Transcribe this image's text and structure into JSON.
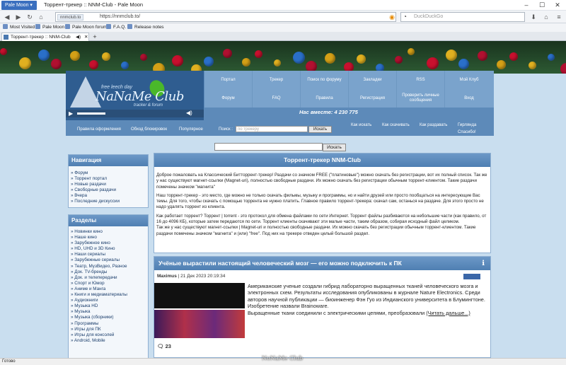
{
  "browser": {
    "app_button": "Pale Moon",
    "window_title": "Торрент-трекер :: NNM-Club - Pale Moon",
    "url_site": "nnmclub.to",
    "url": "https://nnmclub.to/",
    "search_placeholder": "DuckDuckGo",
    "bookmarks": [
      "Most Visited",
      "Pale Moon",
      "Pale Moon forum",
      "F.A.Q.",
      "Release notes"
    ],
    "tab_title": "Торрент-трекер :: NNM-Club",
    "status": "Готово"
  },
  "site": {
    "logo_top": "free leech day",
    "logo": "NaNaMe Club",
    "logo_sub": "tracker & forum",
    "watermark": "NoNaMe Club",
    "menu": [
      "Портал",
      "Трекер",
      "Поиск по форуму",
      "Закладки",
      "RSS",
      "Мой Клуб",
      "Форум",
      "FAQ",
      "Правила",
      "Регистрация",
      "Проверить личные сообщения",
      "Вход"
    ],
    "online": "Нас вместе: 4 230 775",
    "links": [
      "Правила оформления",
      "Обход блокировок",
      "Популярное"
    ],
    "search_label": "Поиск :",
    "search_placeholder": "по трекеру",
    "search_button": "Искать",
    "right_links": [
      "Как искать",
      "Как скачивать",
      "Как раздавать",
      "Гирлянда",
      "Спасибо!"
    ],
    "main_search_button": "Искать"
  },
  "nav": {
    "title": "Навигация",
    "items": [
      "Форум",
      "Торрент портал",
      "Новые раздачи",
      "Свободные раздачи",
      "Вчера",
      "Последние дискуссии"
    ]
  },
  "sections": {
    "title": "Разделы",
    "items": [
      "Новинки кино",
      "Наше кино",
      "Зарубежное кино",
      "HD, UHD и 3D Кино",
      "Наши сериалы",
      "Зарубежные сериалы",
      "Театр, МузВидео, Разное",
      "Док. TV-бренды",
      "Док. и телепередачи",
      "Спорт и Юмор",
      "Аниме и Манга",
      "Книги и медиаматериалы",
      "Аудиокниги",
      "Музыка HD",
      "Музыка",
      "Музыка (сборники)",
      "Программы",
      "Игры для ПК",
      "Игры для консолей",
      "Android, Mobile"
    ]
  },
  "main": {
    "title": "Торрент-трекер NNM-Club",
    "p1": "Доброе пожаловать на Классический Битторрент-трекер! Раздачи со значком FREE (\"платиновые\") можно скачать без регистрации, вот их полный список. Так же у нас существуют магнет-ссылки (Magnet-uri), полностью свободные раздачи. Их можно скачать без регистрации обычным торрент-клиентом. Такие раздачи помечены значком \"магнита\"",
    "p2": "Наш торрент-трекер - это место, где можно не только скачать фильмы, музыку и программы, но и найти друзей или просто пообщаться на интересующие Вас темы. Для того, чтобы скачать с помощью торрента не нужно платить. Главное правило торрент-трекера: скачал сам, останься на раздаче. Для этого просто не надо удалять торрент из клиента.",
    "p3": "Как работает торрент? Торрент | torrent - это протокол для обмена файлами по сети Интернет. Торрент файлы разбиваются на небольшие части (как правило, от 16 до 4096 КБ), которые затем передаются по сети. Торрент клиенты скачивают эти малые части, таким образом, собирая исходный файл целиком.",
    "p4": "Так же у нас существуют магнет-ссылки | Magnet-uri и полностью свободные раздачи. Их можно скачать без регистрации обычным торрент-клиентом. Такие раздачи помечены значком \"магнита\" и (или) \"free\". Под них на трекере отведен целый большой раздел."
  },
  "news": {
    "title": "Учёные вырастили настоящий человеческий мозг — его можно подключить к ПК",
    "author": "Maximus",
    "date": "21 Дек 2023 20:19:34",
    "text": "Американские ученые создали гибрид лабораторно выращенных тканей человеческого мозга и электронных схем. Результаты исследования опубликованы в журнале Nature Electronics. Среди авторов научной публикации — биоинженер Фэн Гуо из Индианского университета в Блумингтоне. Изобретение назвали Brainoware.",
    "text2": "Выращенные ткани соединили с электрическими цепями, преобразовали",
    "more": "(Читать дальше...)",
    "comments": "23"
  }
}
